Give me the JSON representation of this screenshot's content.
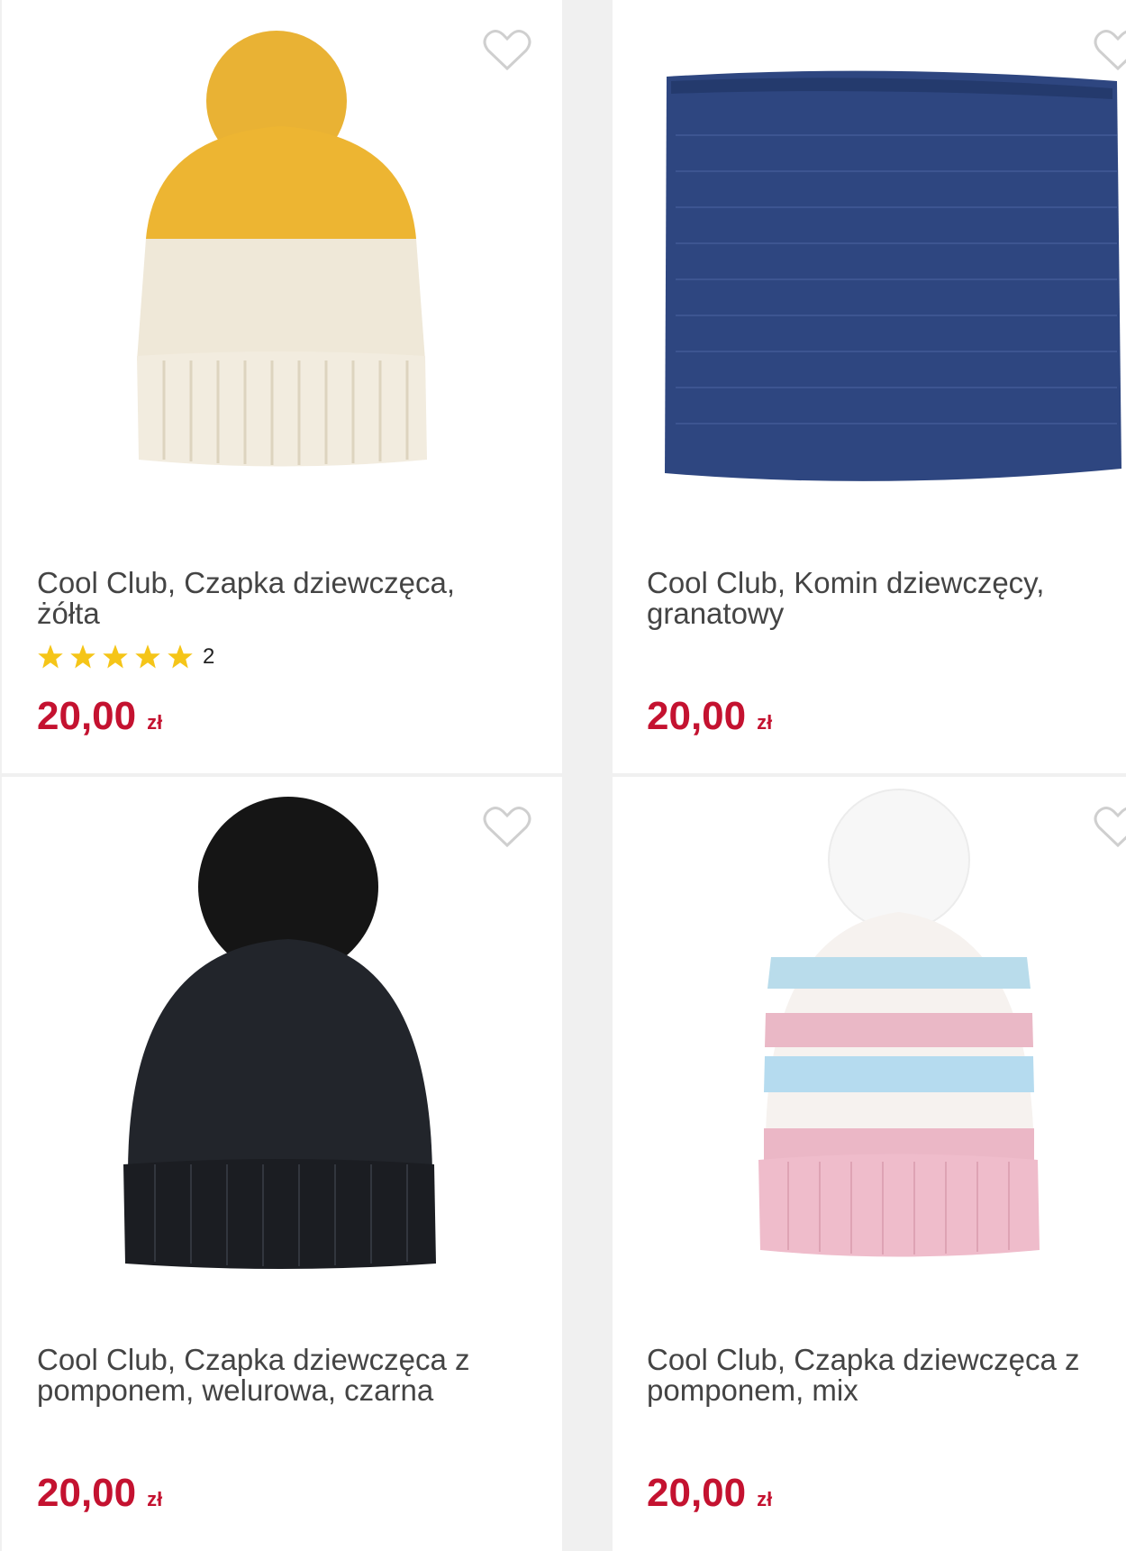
{
  "products": [
    {
      "title": "Cool Club, Czapka dziewczęca, żółta",
      "rating_count": "2",
      "stars": 5,
      "price": "20,00",
      "currency": "zł",
      "image": "yellow-white-pompom-beanie"
    },
    {
      "title": "Cool Club, Komin dziewczęcy, granatowy",
      "price": "20,00",
      "currency": "zł",
      "image": "navy-knit-snood"
    },
    {
      "title": "Cool Club, Czapka dziewczęca z pomponem, welurowa, czarna",
      "price": "20,00",
      "currency": "zł",
      "image": "black-velour-pompom-beanie"
    },
    {
      "title": "Cool Club, Czapka dziewczęca z pomponem, mix",
      "price": "20,00",
      "currency": "zł",
      "image": "striped-pastel-pompom-beanie"
    }
  ],
  "icons": {
    "favorite": "heart-outline-icon",
    "rating": "star-icon"
  },
  "colors": {
    "price": "#c41230",
    "star": "#f5c518",
    "title": "#444444"
  }
}
